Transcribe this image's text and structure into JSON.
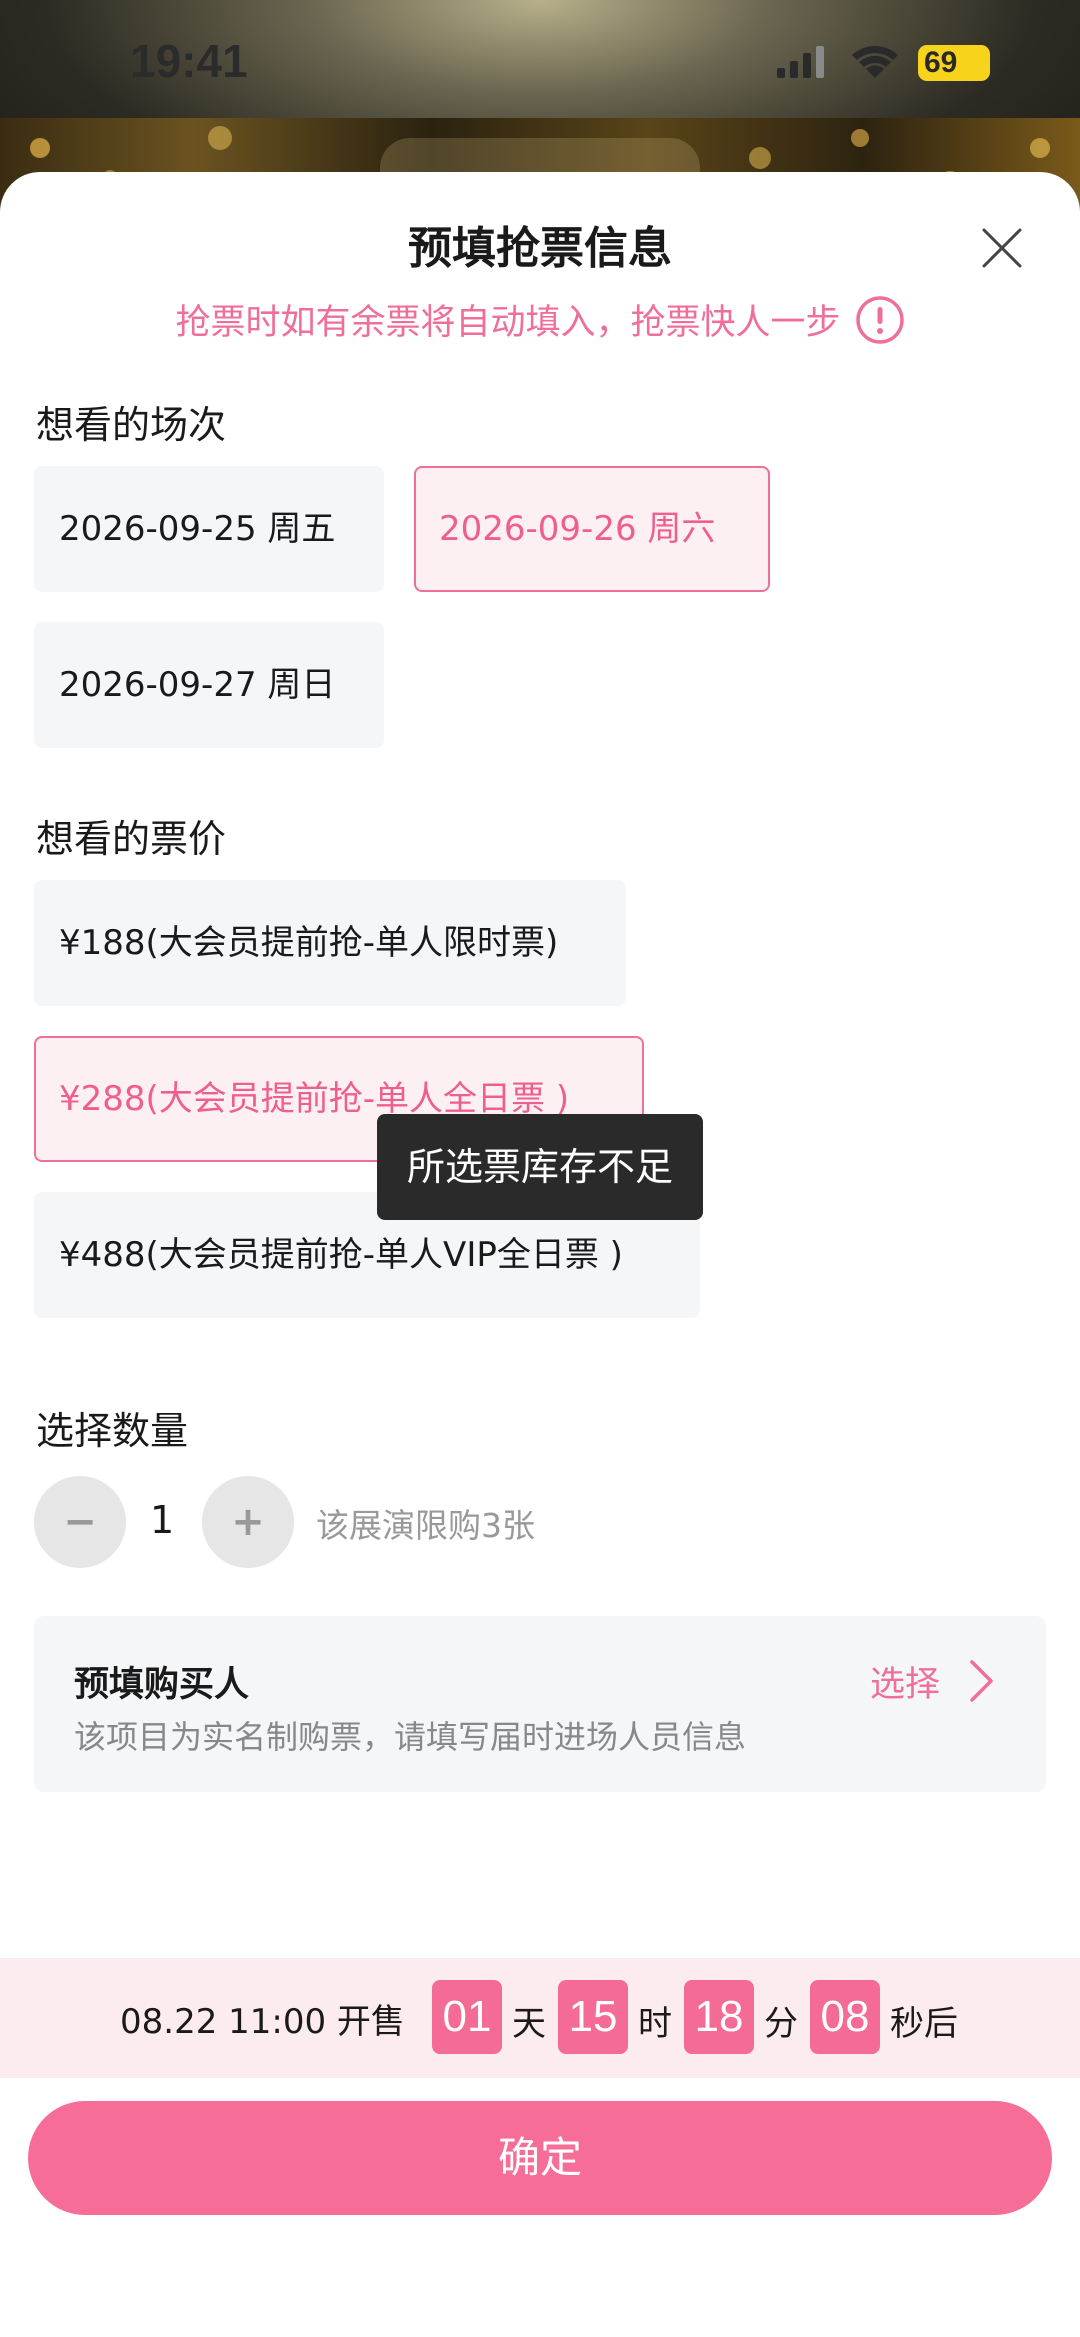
{
  "status_bar": {
    "time": "19:41",
    "battery": "69"
  },
  "sheet": {
    "title": "预填抢票信息",
    "notice": "抢票时如有余票将自动填入，抢票快人一步"
  },
  "sessions": {
    "label": "想看的场次",
    "options": [
      {
        "text": "2026-09-25 周五",
        "selected": false
      },
      {
        "text": "2026-09-26 周六",
        "selected": true
      },
      {
        "text": "2026-09-27 周日",
        "selected": false
      }
    ]
  },
  "prices": {
    "label": "想看的票价",
    "options": [
      {
        "text": "¥188(大会员提前抢-单人限时票)",
        "selected": false
      },
      {
        "text": "¥288(大会员提前抢-单人全日票 )",
        "selected": true
      },
      {
        "text": "¥488(大会员提前抢-单人VIP全日票 )",
        "selected": false
      }
    ]
  },
  "tooltip": "所选票库存不足",
  "quantity": {
    "label": "选择数量",
    "minus": "−",
    "value": "1",
    "plus": "+",
    "limit_text": "该展演限购3张"
  },
  "buyer": {
    "title": "预填购买人",
    "description": "该项目为实名制购票，请填写届时进场人员信息",
    "select_label": "选择"
  },
  "countdown": {
    "sale_time": "08.22 11:00 开售",
    "days": "01",
    "days_unit": "天",
    "hours": "15",
    "hours_unit": "时",
    "minutes": "18",
    "minutes_unit": "分",
    "seconds": "08",
    "seconds_unit": "秒后"
  },
  "confirm_label": "确定",
  "colors": {
    "accent": "#f66e98",
    "accent_text": "#ef5f8e",
    "option_bg": "#f4f6f8",
    "selected_bg": "#fdf0f3",
    "countdown_bg": "#fdecef",
    "tooltip_bg": "#2a2a2a"
  }
}
